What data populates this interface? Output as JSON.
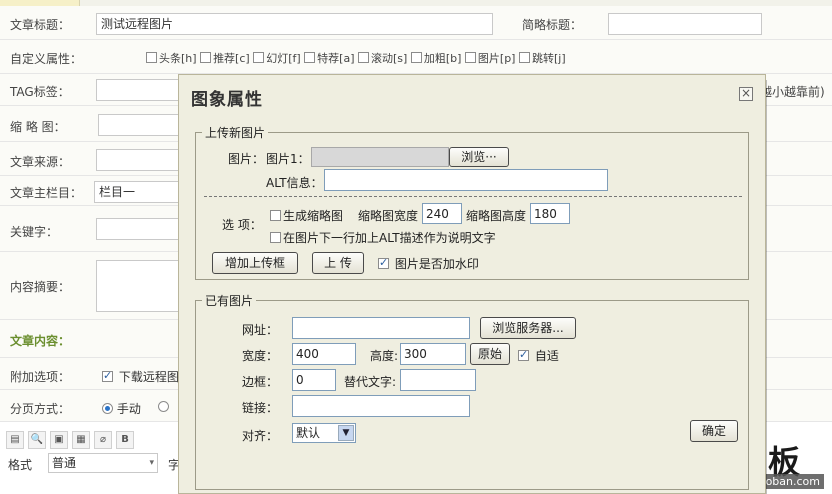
{
  "form": {
    "title_label": "文章标题：",
    "title_value": "测试远程图片",
    "short_title_label": "简略标题：",
    "attr_label": "自定义属性：",
    "attrs": [
      "头条[h]",
      "推荐[c]",
      "幻灯[f]",
      "特荐[a]",
      "滚动[s]",
      "加粗[b]",
      "图片[p]",
      "跳转[j]"
    ],
    "tag_label": "TAG标签：",
    "tag_hint": "越小越靠前)",
    "thumb_label": "缩 略 图：",
    "source_label": "文章来源：",
    "column_label": "文章主栏目：",
    "column_value": "栏目一",
    "keyword_label": "关键字：",
    "summary_label": "内容摘要：",
    "content_label": "文章内容：",
    "extra_label": "附加选项：",
    "extra_option": "下载远程图",
    "paging_label": "分页方式：",
    "paging_manual": "手动",
    "format_label": "格式",
    "format_value": "普通",
    "font_label": "字体"
  },
  "watermark": {
    "text": "最模板",
    "url": "www.zuimoban.com"
  },
  "dialog": {
    "title": "图象属性",
    "close_icon": "close-icon",
    "upload": {
      "legend": "上传新图片",
      "image_label": "图片：",
      "image1_label": "图片1：",
      "browse_button": "浏览···",
      "alt_label": "ALT信息：",
      "options_label": "选 项：",
      "gen_thumb_label": "生成缩略图",
      "thumb_width_label": "缩略图宽度",
      "thumb_width_value": "240",
      "thumb_height_label": "缩略图高度",
      "thumb_height_value": "180",
      "alt_caption_label": "在图片下一行加上ALT描述作为说明文字",
      "add_upload_button": "增加上传框",
      "upload_button": "上 传",
      "watermark_label": "图片是否加水印"
    },
    "existing": {
      "legend": "已有图片",
      "url_label": "网址：",
      "browse_server_button": "浏览服务器...",
      "width_label": "宽度：",
      "width_value": "400",
      "height_label": "高度:",
      "height_value": "300",
      "original_button": "原始",
      "auto_label": "自适",
      "border_label": "边框：",
      "border_value": "0",
      "alt_text_label": "替代文字:",
      "link_label": "链接：",
      "align_label": "对齐：",
      "align_value": "默认",
      "ok_button": "确定"
    }
  }
}
